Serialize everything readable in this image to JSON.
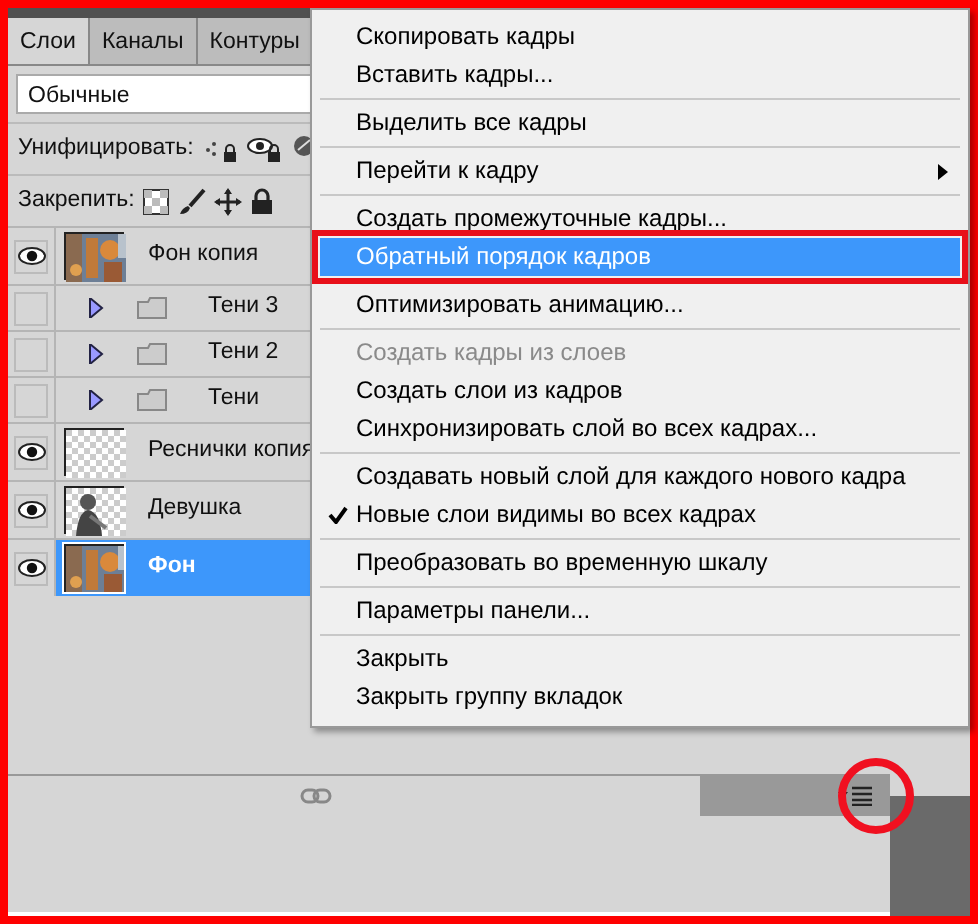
{
  "tabs": [
    {
      "label": "Слои",
      "selected": true
    },
    {
      "label": "Каналы",
      "selected": false
    },
    {
      "label": "Контуры",
      "selected": false
    }
  ],
  "blend_mode": {
    "value": "Обычные"
  },
  "unify": {
    "label": "Унифицировать:"
  },
  "lock": {
    "label": "Закрепить:"
  },
  "layers": [
    {
      "name": "Фон копия",
      "visible": true,
      "selected": false
    },
    {
      "name": "Тени 3",
      "kind": "group",
      "visible": false,
      "selected": false,
      "expanded": false
    },
    {
      "name": "Тени 2",
      "kind": "group",
      "visible": false,
      "selected": false,
      "expanded": false
    },
    {
      "name": "Тени",
      "kind": "group",
      "visible": false,
      "selected": false,
      "expanded": false
    },
    {
      "name": "Реснички копия",
      "kind": "transparent",
      "visible": true,
      "selected": false
    },
    {
      "name": "Девушка",
      "kind": "figure",
      "visible": true,
      "selected": false
    },
    {
      "name": "Фон",
      "visible": true,
      "selected": true
    }
  ],
  "panel_menu_button": {
    "circled": true
  },
  "menu": [
    [
      {
        "label": "Скопировать кадры",
        "disabled": false,
        "checked": false,
        "selected": false,
        "submenu": false
      },
      {
        "label": "Вставить кадры...",
        "disabled": false,
        "checked": false,
        "selected": false,
        "submenu": false
      }
    ],
    [
      {
        "label": "Выделить все кадры",
        "disabled": false,
        "checked": false,
        "selected": false,
        "submenu": false
      }
    ],
    [
      {
        "label": "Перейти к кадру",
        "disabled": false,
        "checked": false,
        "selected": false,
        "submenu": true
      }
    ],
    [
      {
        "label": "Создать промежуточные кадры...",
        "disabled": false,
        "checked": false,
        "selected": false,
        "submenu": false
      },
      {
        "label": "Обратный порядок кадров",
        "disabled": false,
        "checked": false,
        "selected": true,
        "submenu": false
      }
    ],
    [
      {
        "label": "Оптимизировать анимацию...",
        "disabled": false,
        "checked": false,
        "selected": false,
        "submenu": false
      }
    ],
    [
      {
        "label": "Создать кадры из слоев",
        "disabled": true,
        "checked": false,
        "selected": false,
        "submenu": false
      },
      {
        "label": "Создать слои из кадров",
        "disabled": false,
        "checked": false,
        "selected": false,
        "submenu": false
      },
      {
        "label": "Синхронизировать слой во всех кадрах...",
        "disabled": false,
        "checked": false,
        "selected": false,
        "submenu": false
      }
    ],
    [
      {
        "label": "Создавать новый слой для каждого нового кадра",
        "disabled": false,
        "checked": false,
        "selected": false,
        "submenu": false
      },
      {
        "label": "Новые слои видимы во всех кадрах",
        "disabled": false,
        "checked": true,
        "selected": false,
        "submenu": false
      }
    ],
    [
      {
        "label": "Преобразовать во временную шкалу",
        "disabled": false,
        "checked": false,
        "selected": false,
        "submenu": false
      }
    ],
    [
      {
        "label": "Параметры панели...",
        "disabled": false,
        "checked": false,
        "selected": false,
        "submenu": false
      }
    ],
    [
      {
        "label": "Закрыть",
        "disabled": false,
        "checked": false,
        "selected": false,
        "submenu": false
      },
      {
        "label": "Закрыть группу вкладок",
        "disabled": false,
        "checked": false,
        "selected": false,
        "submenu": false
      }
    ]
  ]
}
